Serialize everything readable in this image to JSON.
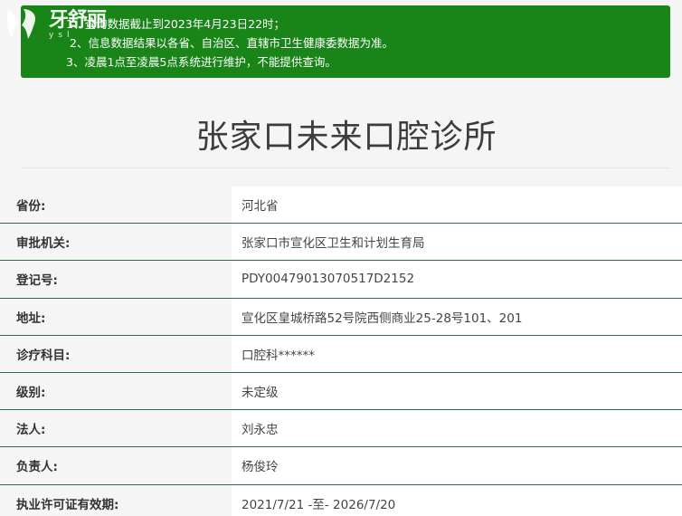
{
  "notice": {
    "lines": [
      "1、查询数据截止到2023年4月23日22时；",
      "2、信息数据结果以各省、自治区、直辖市卫生健康委数据为准。",
      "3、凌晨1点至凌晨5点系统进行维护，不能提供查询。"
    ]
  },
  "logo": {
    "text": "牙舒丽",
    "sub": "ysl"
  },
  "title": "张家口未来口腔诊所",
  "info": [
    {
      "label": "省份:",
      "value": "河北省"
    },
    {
      "label": "审批机关:",
      "value": "张家口市宣化区卫生和计划生育局"
    },
    {
      "label": "登记号:",
      "value": "PDY00479013070517D2152"
    },
    {
      "label": "地址:",
      "value": "宣化区皇城桥路52号院西侧商业25-28号101、201"
    },
    {
      "label": "诊疗科目:",
      "value": "口腔科******"
    },
    {
      "label": "级别:",
      "value": "未定级"
    },
    {
      "label": "法人:",
      "value": "刘永忠"
    },
    {
      "label": "负责人:",
      "value": "杨俊玲"
    },
    {
      "label": "执业许可证有效期:",
      "value": "2021/7/21 -至- 2026/7/20"
    }
  ],
  "colors": {
    "notice_bg": "#198418",
    "row_border": "#2c6e40",
    "title": "#3c3c3c"
  }
}
